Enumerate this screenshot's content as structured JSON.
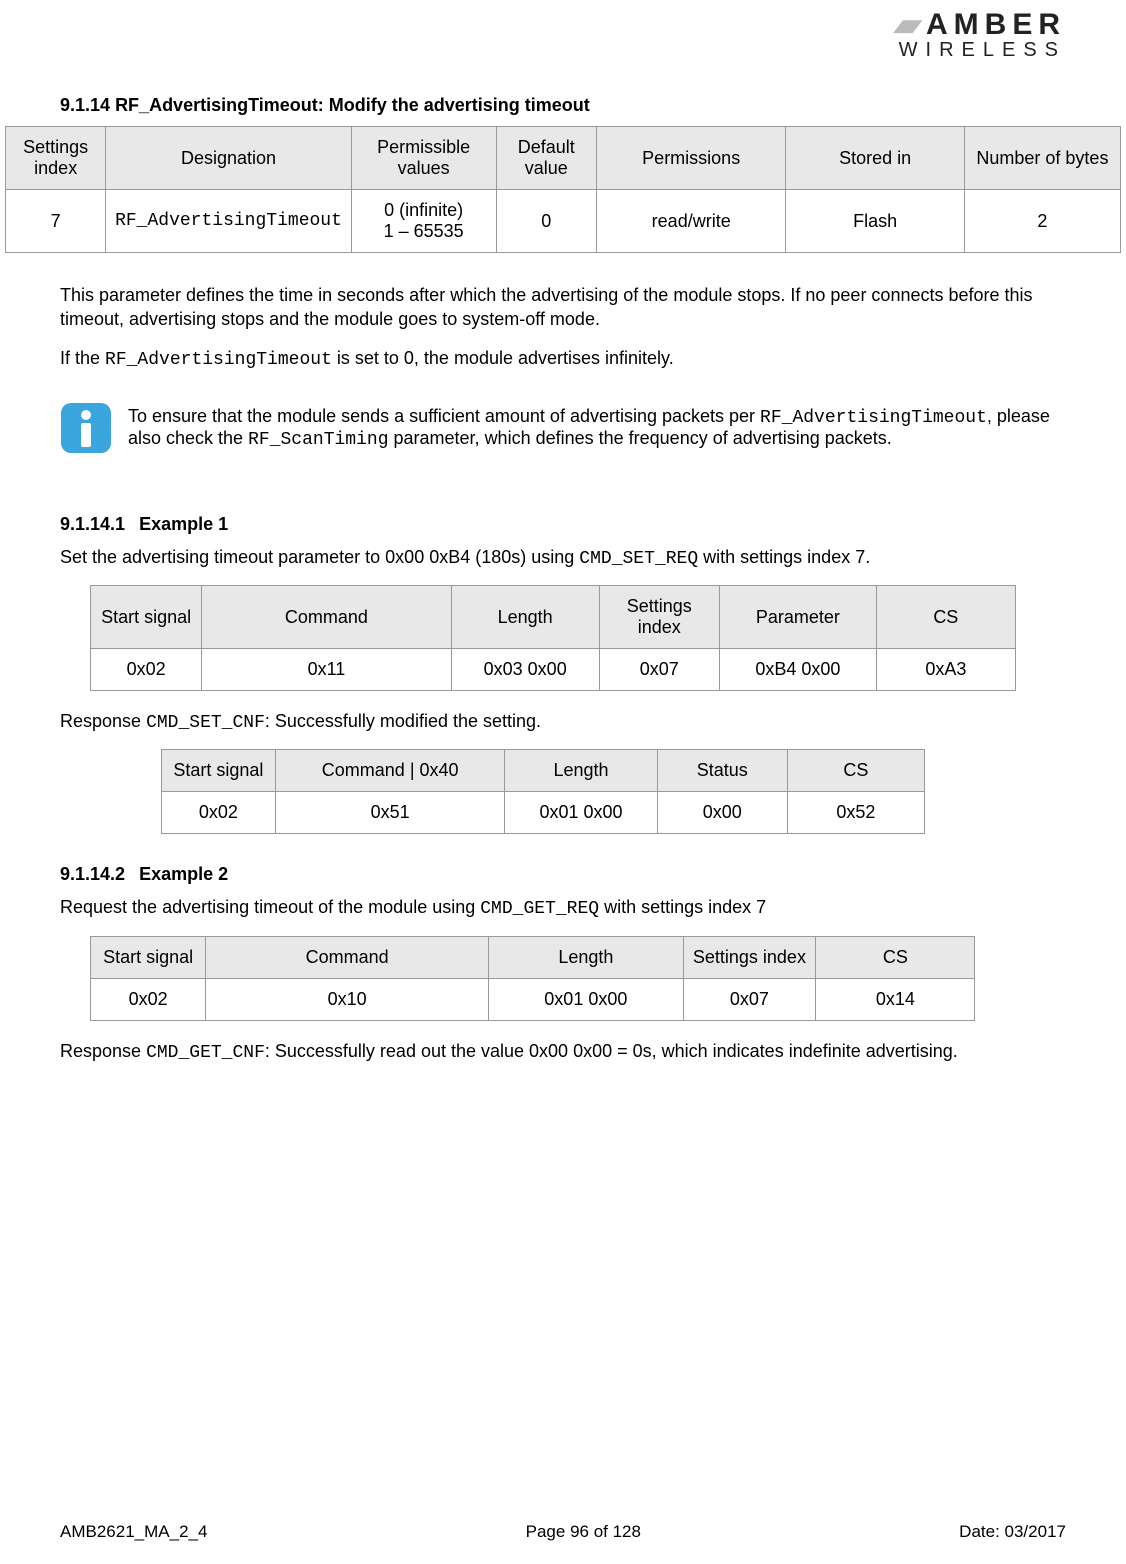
{
  "logo": {
    "top": "AMBER",
    "bottom": "WIRELESS"
  },
  "section": {
    "number": "9.1.14",
    "title": "RF_AdvertisingTimeout: Modify the advertising timeout"
  },
  "settings_table": {
    "headers": [
      "Settings index",
      "Designation",
      "Permissible values",
      "Default value",
      "Permissions",
      "Stored in",
      "Number of bytes"
    ],
    "row": {
      "index": "7",
      "designation": "RF_AdvertisingTimeout",
      "permissible_l1": "0 (infinite)",
      "permissible_l2": "1 – 65535",
      "default": "0",
      "permissions": "read/write",
      "stored": "Flash",
      "bytes": "2"
    }
  },
  "para1": "This parameter defines the time in seconds after which the advertising of the module stops. If no peer connects before this timeout, advertising stops and the module goes to system-off mode.",
  "para2_pre": "If the ",
  "para2_code": "RF_AdvertisingTimeout",
  "para2_post": " is set to 0, the module advertises infinitely.",
  "note": {
    "t1": "To ensure that the module sends a sufficient amount of advertising packets per ",
    "c1": "RF_AdvertisingTimeout",
    "t2": ", please also check the ",
    "c2": "RF_ScanTiming",
    "t3": " parameter, which defines the frequency of advertising packets."
  },
  "ex1": {
    "number": "9.1.14.1",
    "title": "Example 1",
    "intro_t1": "Set the advertising timeout parameter to 0x00 0xB4 (180s) using ",
    "intro_c1": "CMD_SET_REQ",
    "intro_t2": " with settings index 7.",
    "req": {
      "headers": [
        "Start signal",
        "Command",
        "Length",
        "Settings index",
        "Parameter",
        "CS"
      ],
      "row": [
        "0x02",
        "0x11",
        "0x03 0x00",
        "0x07",
        "0xB4 0x00",
        "0xA3"
      ]
    },
    "resp_pre": "Response ",
    "resp_code": "CMD_SET_CNF",
    "resp_post": ": Successfully modified the setting.",
    "cnf": {
      "headers": [
        "Start signal",
        "Command | 0x40",
        "Length",
        "Status",
        "CS"
      ],
      "row": [
        "0x02",
        "0x51",
        "0x01 0x00",
        "0x00",
        "0x52"
      ]
    }
  },
  "ex2": {
    "number": "9.1.14.2",
    "title": "Example 2",
    "intro_t1": "Request the advertising timeout of the module using ",
    "intro_c1": "CMD_GET_REQ",
    "intro_t2": " with settings index 7",
    "req": {
      "headers": [
        "Start signal",
        "Command",
        "Length",
        "Settings index",
        "CS"
      ],
      "row": [
        "0x02",
        "0x10",
        "0x01 0x00",
        "0x07",
        "0x14"
      ]
    },
    "resp_pre": "Response ",
    "resp_code": "CMD_GET_CNF",
    "resp_post": ": Successfully read out the value 0x00 0x00 = 0s, which indicates indefinite advertising."
  },
  "footer": {
    "doc": "AMB2621_MA_2_4",
    "page": "Page 96 of 128",
    "date": "Date: 03/2017"
  }
}
